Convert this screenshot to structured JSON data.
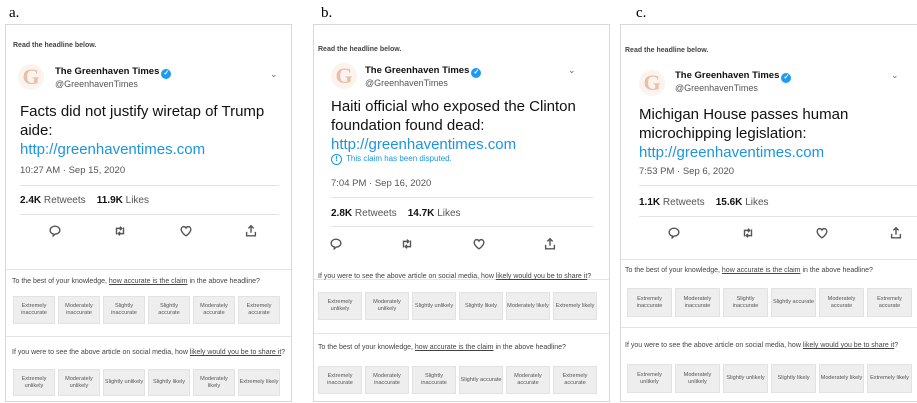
{
  "panels": [
    {
      "label": "a.",
      "instruction": "Read the headline below.",
      "account": "The Greenhaven Times",
      "handle": "@GreenhavenTimes",
      "headline": "Facts did not justify wiretap of Trump aide:",
      "link": "http://greenhaventimes.com",
      "disputed": "",
      "timestamp": "10:27 AM · Sep 15, 2020",
      "retweets": "2.4K",
      "retweets_label": "Retweets",
      "likes": "11.9K",
      "likes_label": "Likes",
      "q1": {
        "pre": "To the best of your knowledge, ",
        "link": "how accurate is the claim",
        "post": " in the above headline?",
        "options": [
          "Extremely inaccurate",
          "Moderately inaccurate",
          "Slightly inaccurate",
          "Slightly accurate",
          "Moderately accurate",
          "Extremely accurate"
        ]
      },
      "q2": {
        "pre": "If you were to see the above article on social media, how ",
        "link": "likely would you be to share it",
        "post": "?",
        "options": [
          "Extremely unlikely",
          "Moderately unlikely",
          "Slightly unlikely",
          "Slightly likely",
          "Moderately likely",
          "Extremely likely"
        ]
      }
    },
    {
      "label": "b.",
      "instruction": "Read the headline below.",
      "account": "The Greenhaven Times",
      "handle": "@GreenhavenTimes",
      "headline": "Haiti official who exposed the Clinton foundation found dead:",
      "link": "http://greenhaventimes.com",
      "disputed": "This claim has been disputed.",
      "timestamp": "7:04 PM · Sep 16, 2020",
      "retweets": "2.8K",
      "retweets_label": "Retweets",
      "likes": "14.7K",
      "likes_label": "Likes",
      "q1": {
        "pre": "If you were to see the above article on social media, how ",
        "link": "likely would you be to share it",
        "post": "?",
        "options": [
          "Extremely unlikely",
          "Moderately unlikely",
          "Slightly unlikely",
          "Slightly likely",
          "Moderately likely",
          "Extremely likely"
        ]
      },
      "q2": {
        "pre": "To the best of your knowledge, ",
        "link": "how accurate is the claim",
        "post": " in the above headline?",
        "options": [
          "Extremely inaccurate",
          "Moderately inaccurate",
          "Slightly inaccurate",
          "Slightly accurate",
          "Moderately accurate",
          "Extremely accurate"
        ]
      }
    },
    {
      "label": "c.",
      "instruction": "Read the headline below.",
      "account": "The Greenhaven Times",
      "handle": "@GreenhavenTimes",
      "headline": "Michigan House passes human microchipping legislation:",
      "link": "http://greenhaventimes.com",
      "disputed": "",
      "timestamp": "7:53 PM · Sep 6, 2020",
      "retweets": "1.1K",
      "retweets_label": "Retweets",
      "likes": "15.6K",
      "likes_label": "Likes",
      "q1": {
        "pre": "To the best of your knowledge, ",
        "link": "how accurate is the claim",
        "post": " in the above headline?",
        "options": [
          "Extremely inaccurate",
          "Moderately inaccurate",
          "Slightly inaccurate",
          "Slightly accurate",
          "Moderately accurate",
          "Extremely accurate"
        ]
      },
      "q2": {
        "pre": "If you were to see the above article on social media, how ",
        "link": "likely would you be to share it",
        "post": "?",
        "options": [
          "Extremely unlikely",
          "Moderately unlikely",
          "Slightly unlikely",
          "Slightly likely",
          "Moderately likely",
          "Extremely likely"
        ]
      }
    }
  ],
  "logo_letter": "G",
  "colors": {
    "link": "#1b95e0",
    "verified": "#1d9bf0",
    "option_bg": "#eeeeee"
  }
}
